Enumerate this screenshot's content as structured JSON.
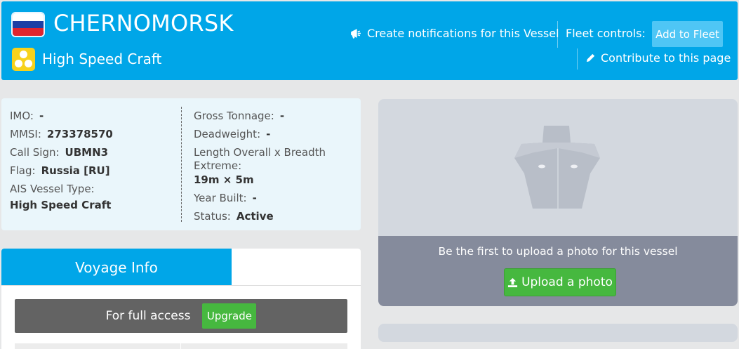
{
  "header": {
    "vessel_name": "CHERNOMORSK",
    "vessel_type": "High Speed Craft",
    "flag_colors": [
      "#ffffff",
      "#1c3fa5",
      "#e0242e"
    ],
    "notify_label": "Create notifications for this Vessel",
    "fleet_label": "Fleet controls:",
    "fleet_button": "Add to Fleet",
    "contribute_label": "Contribute to this page",
    "accent_color": "#00a6e8"
  },
  "details": {
    "left": [
      {
        "label": "IMO:",
        "value": "-"
      },
      {
        "label": "MMSI:",
        "value": "273378570"
      },
      {
        "label": "Call Sign:",
        "value": "UBMN3"
      },
      {
        "label": "Flag:",
        "value": "Russia [RU]"
      },
      {
        "label": "AIS Vessel Type:",
        "value": "High Speed Craft"
      }
    ],
    "right": [
      {
        "label": "Gross Tonnage:",
        "value": "-"
      },
      {
        "label": "Deadweight:",
        "value": "-"
      },
      {
        "label": "Length Overall x Breadth Extreme:",
        "value": "19m × 5m"
      },
      {
        "label": "Year Built:",
        "value": "-"
      },
      {
        "label": "Status:",
        "value": "Active"
      }
    ]
  },
  "voyage": {
    "tab_label": "Voyage Info",
    "access_text": "For full access",
    "upgrade_button": "Upgrade"
  },
  "photo": {
    "prompt": "Be the first to upload a photo for this vessel",
    "upload_button": "Upload a photo"
  }
}
